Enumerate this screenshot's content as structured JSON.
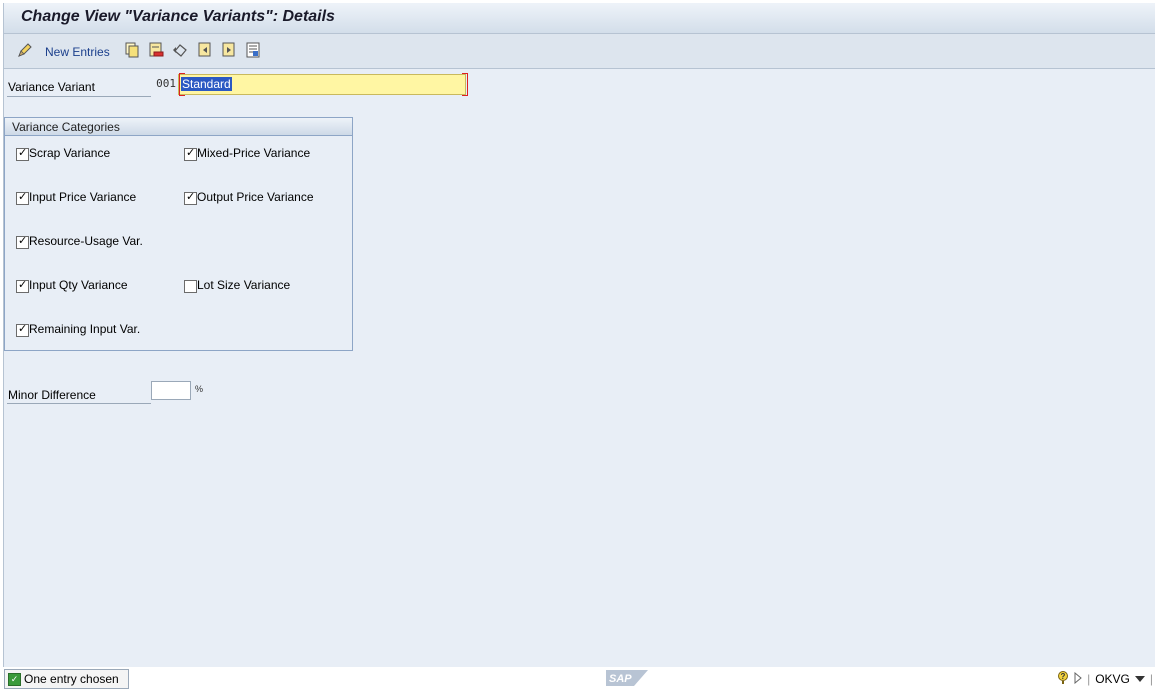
{
  "window": {
    "title": "Change View \"Variance Variants\": Details"
  },
  "toolbar": {
    "new_entries_label": "New Entries",
    "icons": [
      "edit-toggle-icon",
      "copy-icon",
      "delete-icon",
      "undo-icon",
      "previous-entry-icon",
      "next-entry-icon",
      "variable-list-icon"
    ]
  },
  "form": {
    "variance_variant_label": "Variance Variant",
    "variance_variant_key": "001",
    "variance_variant_value": "Standard",
    "minor_difference_label": "Minor Difference",
    "minor_difference_value": "",
    "minor_difference_unit": "%"
  },
  "variance_categories": {
    "title": "Variance Categories",
    "items": [
      {
        "label": "Scrap Variance",
        "checked": true
      },
      {
        "label": "Mixed-Price Variance",
        "checked": true
      },
      {
        "label": "Input Price Variance",
        "checked": true
      },
      {
        "label": "Output Price Variance",
        "checked": true
      },
      {
        "label": "Resource-Usage Var.",
        "checked": true
      },
      {
        "label": "Input Qty Variance",
        "checked": true
      },
      {
        "label": "Lot Size Variance",
        "checked": false
      },
      {
        "label": "Remaining Input Var.",
        "checked": true
      }
    ]
  },
  "statusbar": {
    "message": "One entry chosen",
    "logo_text": "SAP",
    "transaction": "OKVG"
  },
  "colors": {
    "background": "#e8eef6",
    "input_required": "#fff6a3",
    "selection": "#2b59c3",
    "link_text": "#1b3f8c"
  }
}
